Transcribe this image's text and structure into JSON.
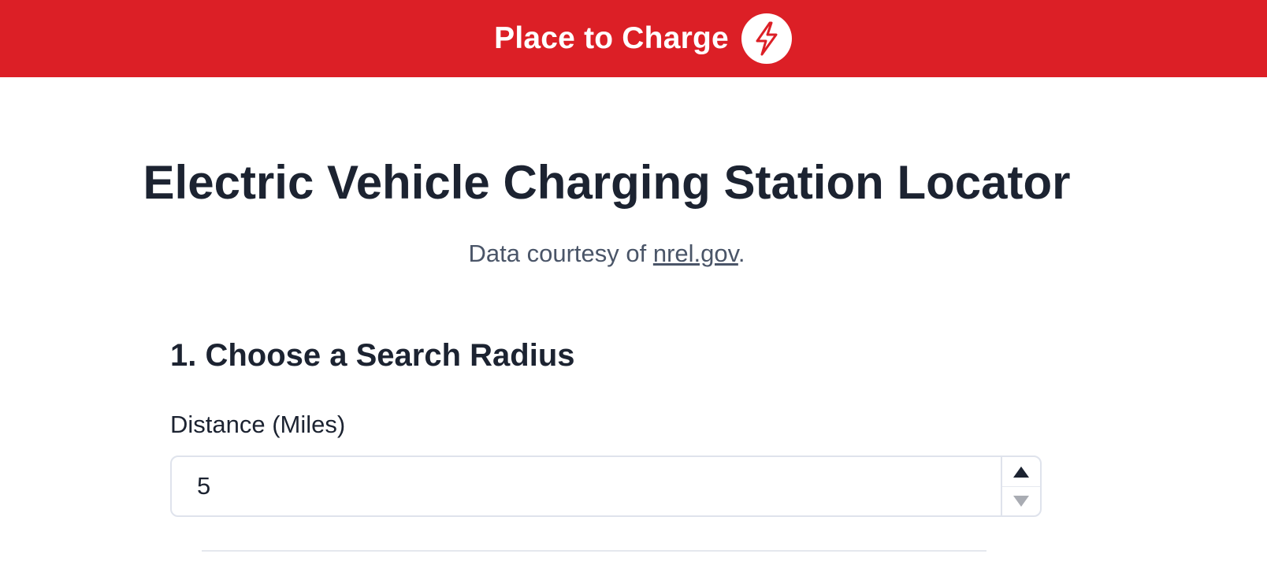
{
  "header": {
    "brand_name": "Place to Charge",
    "logo_icon": "lightning-bolt-icon",
    "background_color": "#dc1f26"
  },
  "main": {
    "title": "Electric Vehicle Charging Station Locator",
    "courtesy_prefix": "Data courtesy of ",
    "courtesy_link": "nrel.gov",
    "courtesy_suffix": "."
  },
  "search_radius": {
    "section_title": "1. Choose a Search Radius",
    "distance_label": "Distance (Miles)",
    "distance_value": "5",
    "increment_icon": "triangle-up-icon",
    "decrement_icon": "triangle-down-icon"
  }
}
